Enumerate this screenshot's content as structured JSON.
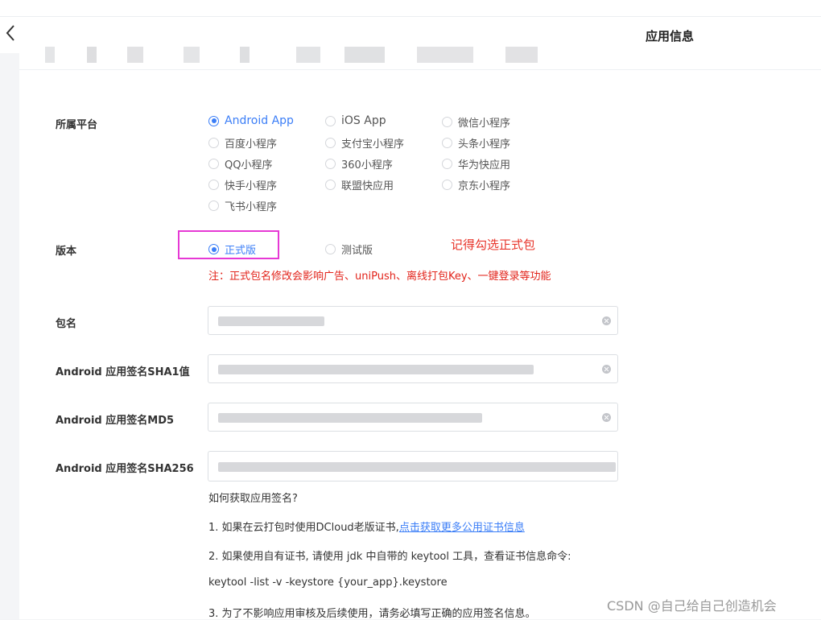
{
  "header": {
    "title": "应用信息"
  },
  "form": {
    "platform": {
      "label": "所属平台",
      "options": [
        "Android App",
        "iOS App",
        "微信小程序",
        "百度小程序",
        "支付宝小程序",
        "头条小程序",
        "QQ小程序",
        "360小程序",
        "华为快应用",
        "快手小程序",
        "联盟快应用",
        "京东小程序",
        "飞书小程序"
      ],
      "selected": "Android App"
    },
    "version": {
      "label": "版本",
      "options": [
        "正式版",
        "测试版"
      ],
      "selected": "正式版",
      "annotation": "记得勾选正式包",
      "note": "注：正式包名修改会影响广告、uniPush、离线打包Key、一键登录等功能"
    },
    "package_label": "包名",
    "sha1_label": "Android 应用签名SHA1值",
    "md5_label": "Android 应用签名MD5",
    "sha256_label": "Android 应用签名SHA256"
  },
  "help": {
    "title": "如何获取应用签名?",
    "line1_prefix": "1. 如果在云打包时使用DCloud老版证书,",
    "line1_link": "点击获取更多公用证书信息",
    "line2": "2. 如果使用自有证书, 请使用 jdk 中自带的 keytool 工具，查看证书信息命令:",
    "command": "keytool -list -v -keystore {your_app}.keystore",
    "line3": "3. 为了不影响应用审核及后续使用，请务必填写正确的应用签名信息。"
  },
  "watermark": "CSDN @自己给自己创造机会"
}
